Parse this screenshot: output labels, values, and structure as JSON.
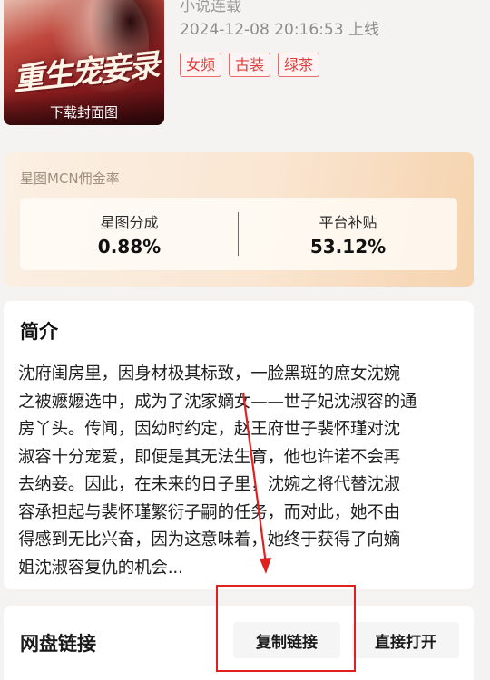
{
  "book": {
    "cover": {
      "title_art": "重生宠妾录",
      "download_label": "下载封面图"
    },
    "meta_partial": "小说连载",
    "online_time": "2024-12-08 20:16:53 上线",
    "tags": [
      "女频",
      "古装",
      "绿茶"
    ]
  },
  "commission": {
    "title": "星图MCN佣金率",
    "stats": [
      {
        "label": "星图分成",
        "value": "0.88%"
      },
      {
        "label": "平台补贴",
        "value": "53.12%"
      }
    ]
  },
  "intro": {
    "heading": "简介",
    "lines": [
      "沈府闺房里，因身材极其标致，一脸黑斑的庶女沈婉",
      "之被嬷嬷选中，成为了沈家嫡女——世子妃沈淑容的通",
      "房丫头。传闻，因幼时约定，赵王府世子裴怀瑾对沈",
      "淑容十分宠爱，即便是其无法生育，他也许诺不会再",
      "去纳妾。因此，在未来的日子里，沈婉之将代替沈淑",
      "容承担起与裴怀瑾繁衍子嗣的任务，而对此，她不由",
      "得感到无比兴奋，因为这意味着，她终于获得了向嫡",
      "姐沈淑容复仇的机会..."
    ]
  },
  "netdisk": {
    "label": "网盘链接",
    "copy_button": "复制链接",
    "open_button": "直接打开"
  },
  "annotation": {
    "color": "#e02020"
  }
}
